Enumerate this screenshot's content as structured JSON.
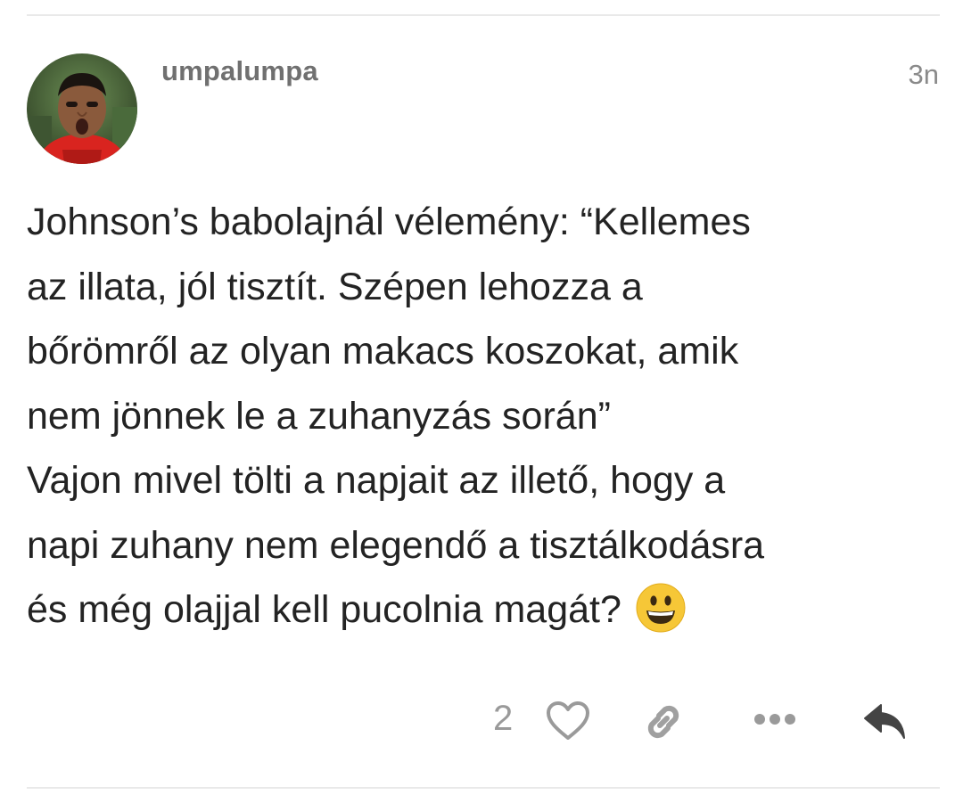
{
  "post": {
    "username": "umpalumpa",
    "timestamp": "3n",
    "avatar_icon": "user-avatar-photo",
    "body_lines": [
      "Johnson’s babolajnál vélemény: “Kellemes",
      "az illata, jól tisztít. Szépen lehozza a",
      "bőrömről az olyan makacs koszokat, amik",
      "nem jönnek le a zuhanyzás során”",
      "Vajon mivel tölti a napjait az illető, hogy a",
      "napi zuhany nem elegendő a tisztálkodásra",
      "és még olajjal kell pucolnia magát?"
    ],
    "trailing_emoji": "grinning-face-emoji"
  },
  "actions": {
    "like_count": "2",
    "icons": [
      "heart-icon",
      "link-icon",
      "more-icon",
      "reply-icon"
    ]
  },
  "colors": {
    "text": "#232323",
    "muted": "#707070",
    "icon": "#9a9a9a",
    "divider": "#e9e9e9",
    "emoji_yellow": "#f6c737"
  }
}
